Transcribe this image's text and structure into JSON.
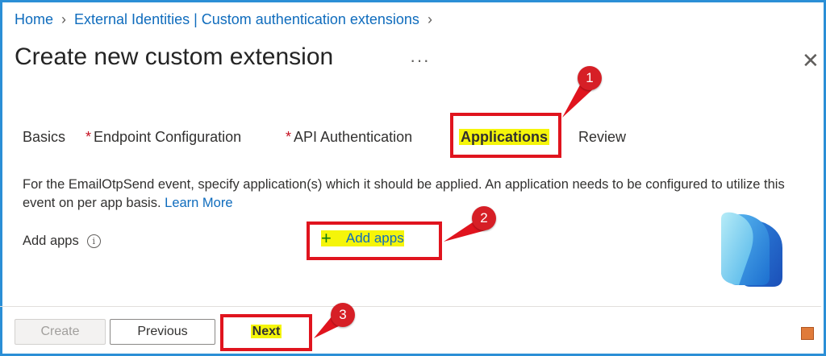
{
  "breadcrumb": {
    "home": "Home",
    "section": "External Identities | Custom authentication extensions"
  },
  "page": {
    "title": "Create new custom extension",
    "more_icon": "ellipsis-icon",
    "close_icon": "close-icon"
  },
  "tabs": [
    {
      "label": "Basics",
      "required": false,
      "active": false
    },
    {
      "label": "Endpoint Configuration",
      "required": true,
      "active": false
    },
    {
      "label": "API Authentication",
      "required": true,
      "active": false
    },
    {
      "label": "Applications",
      "required": false,
      "active": true
    },
    {
      "label": "Review",
      "required": false,
      "active": false
    }
  ],
  "content": {
    "description": "For the EmailOtpSend event, specify application(s) which it should be applied. An application needs to be configured to utilize this event on per app basis.",
    "learn_more": "Learn More",
    "add_apps_label": "Add apps",
    "add_apps_button": "Add apps"
  },
  "footer": {
    "create": "Create",
    "previous": "Previous",
    "next": "Next"
  },
  "annotations": {
    "badges": [
      "1",
      "2",
      "3"
    ],
    "color": "#e0141e"
  },
  "colors": {
    "link": "#0f6cbd",
    "highlight": "#f5f50a",
    "frame": "#2b8fd6"
  }
}
